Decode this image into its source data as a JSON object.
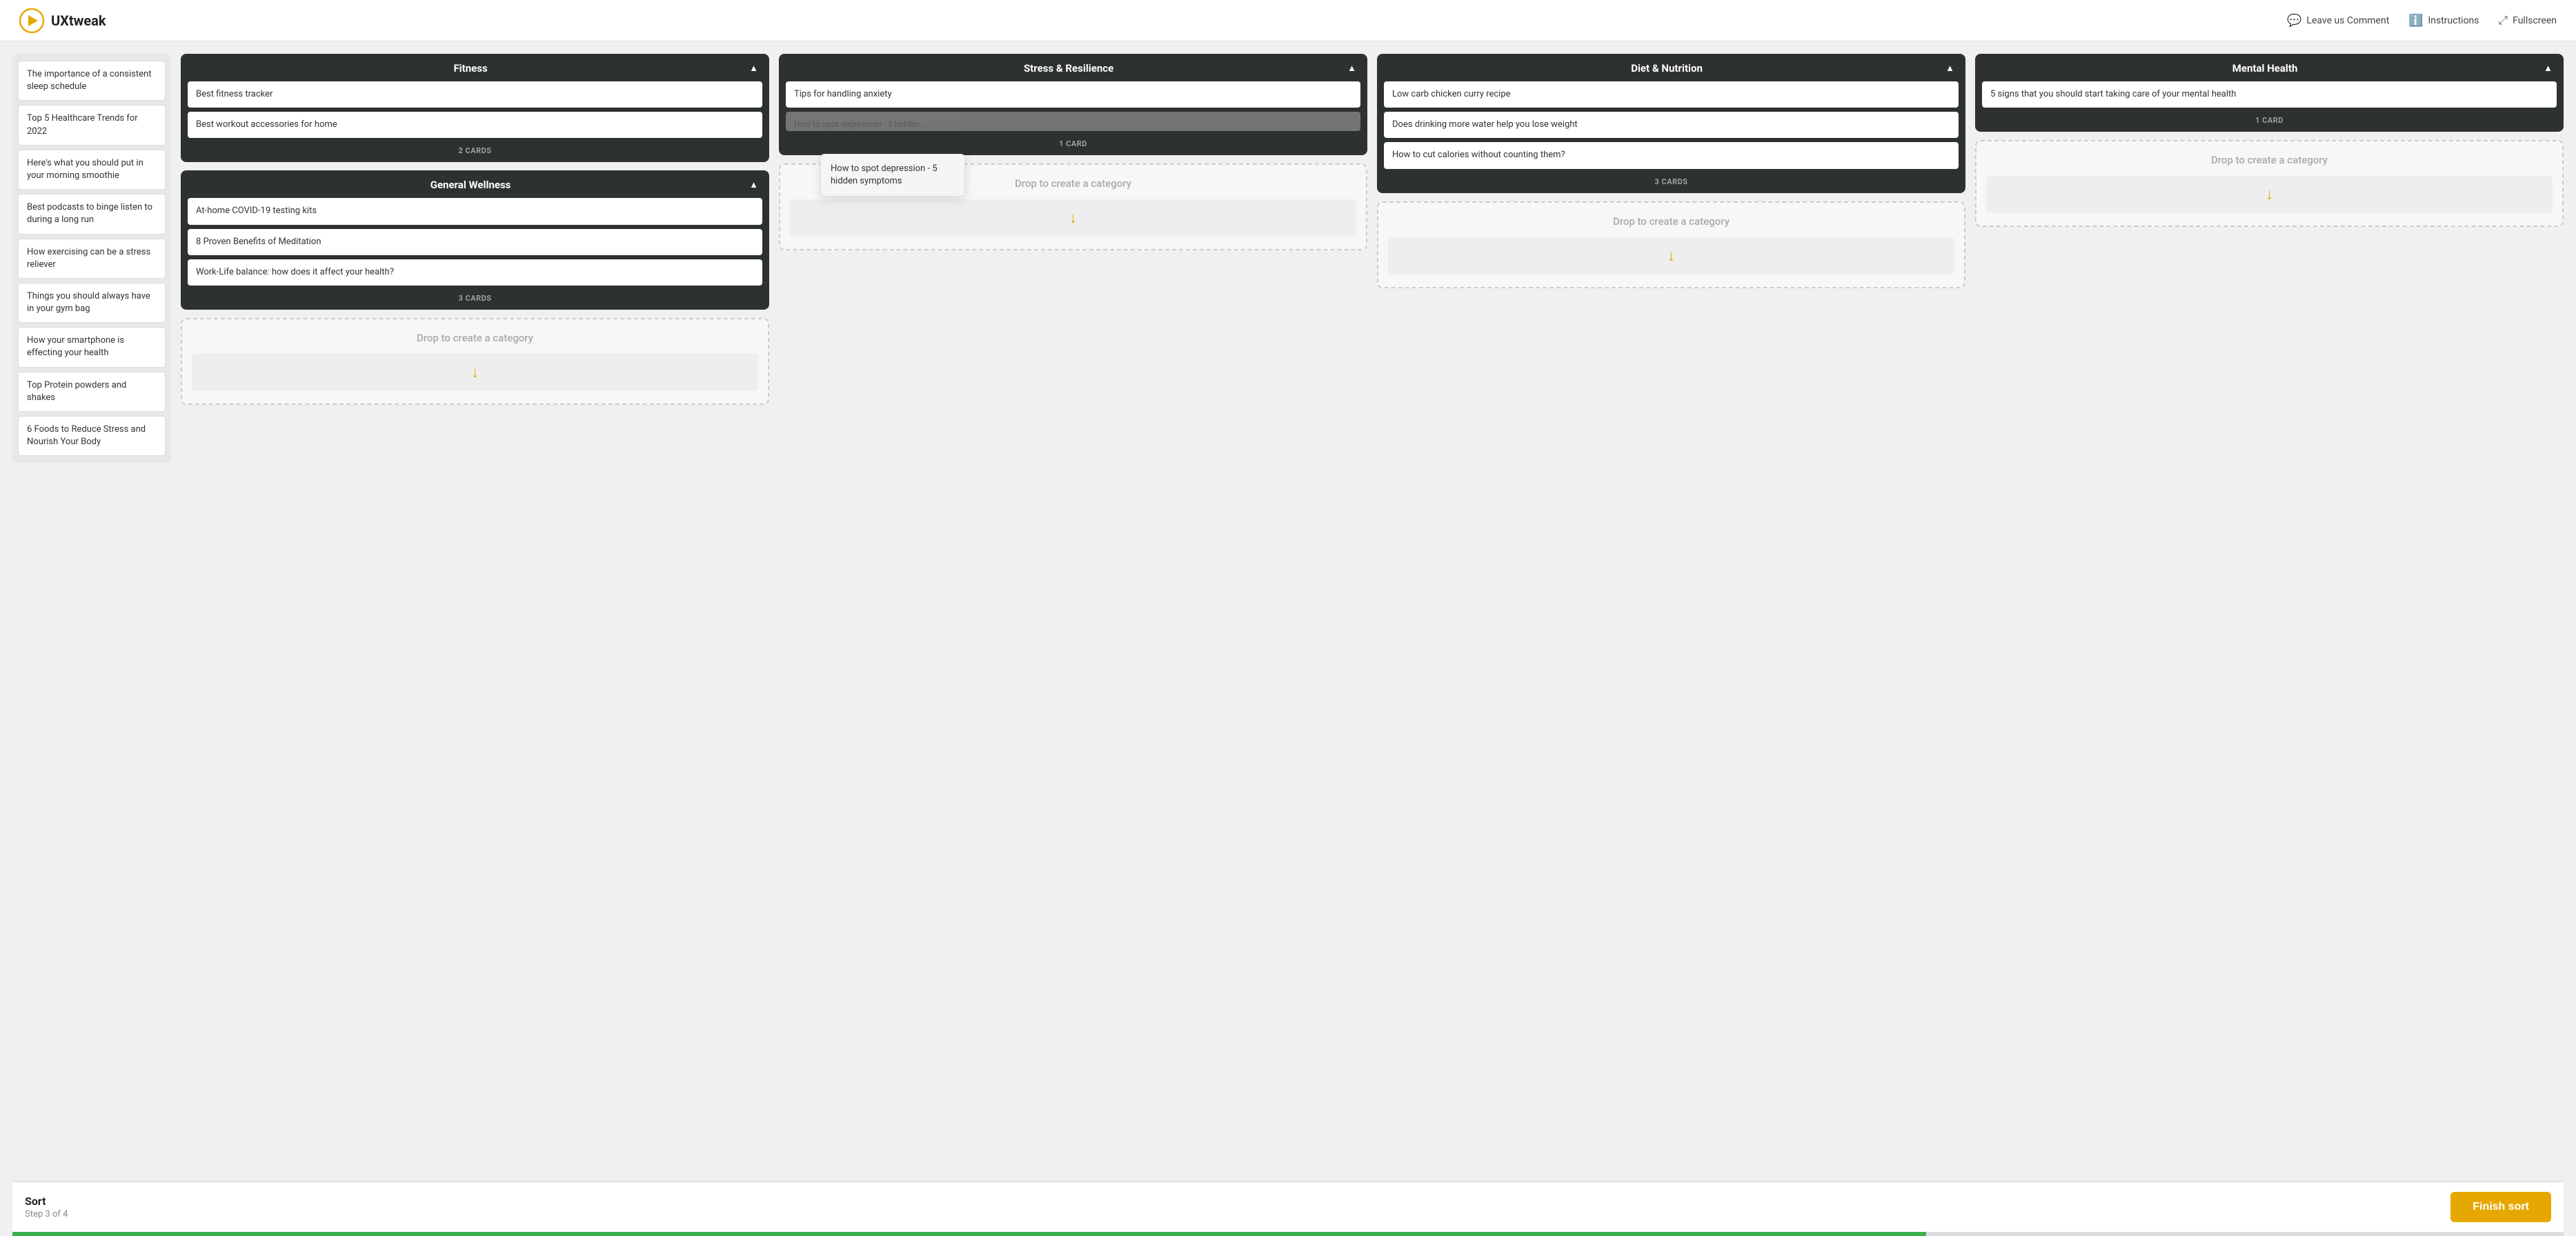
{
  "header": {
    "logo_text": "UXtweak",
    "action_comment": "Leave us Comment",
    "action_instructions": "Instructions",
    "action_fullscreen": "Fullscreen"
  },
  "cards_list": {
    "items": [
      "The importance of a consistent sleep schedule",
      "Top 5 Healthcare Trends for 2022",
      "Here's what you should put in your morning smoothie",
      "Best podcasts to binge listen to during a long run",
      "How exercising can be a stress reliever",
      "Things you should always have in your gym bag",
      "How your smartphone is effecting your health",
      "Top Protein powders and shakes",
      "6 Foods to Reduce Stress and Nourish Your Body"
    ]
  },
  "categories": [
    {
      "id": "fitness",
      "title": "Fitness",
      "cards": [
        "Best fitness tracker",
        "Best workout accessories for home"
      ],
      "card_count": "2 CARDS"
    },
    {
      "id": "general_wellness",
      "title": "General Wellness",
      "cards": [
        "At-home COVID-19 testing kits",
        "8 Proven Benefits of Meditation",
        "Work-Life balance: how does it affect your health?"
      ],
      "card_count": "3 CARDS"
    },
    {
      "id": "stress",
      "title": "Stress & Resilience",
      "cards": [
        "Tips for handling anxiety"
      ],
      "partial_card": "How to spot depression - 5 hidden symptoms",
      "card_count": "1 CARD"
    },
    {
      "id": "diet",
      "title": "Diet & Nutrition",
      "cards": [
        "Low carb chicken curry recipe",
        "Does drinking more water help you lose weight",
        "How to cut calories without counting them?"
      ],
      "card_count": "3 CARDS"
    },
    {
      "id": "mental",
      "title": "Mental Health",
      "cards": [
        "5 signs that you should start taking care of your mental health"
      ],
      "card_count": "1 CARD"
    }
  ],
  "drop_zone_text": "Drop to create a category",
  "tooltip_card_text": "How to spot depression - 5 hidden symptoms",
  "bottom_bar": {
    "sort_label": "Sort",
    "step_label": "Step 3 of 4",
    "finish_button": "Finish sort"
  },
  "progress": {
    "percent": 75
  }
}
